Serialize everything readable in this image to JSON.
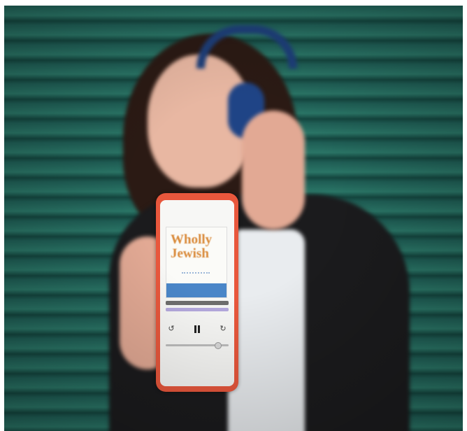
{
  "photo": {
    "subject": "Woman with headphones holding a phone"
  },
  "phone": {
    "app": {
      "cover_title": "Wholly Jewish",
      "cover_strip_text": "",
      "icons": {
        "rewind": "rewind-icon",
        "pause": "pause-icon",
        "forward": "forward-icon"
      }
    }
  },
  "colors": {
    "background_stripes": "#1f5e55",
    "phone_case": "#e8573c",
    "cover_title": "#d98a3a",
    "cover_strip": "#4a86c8"
  }
}
